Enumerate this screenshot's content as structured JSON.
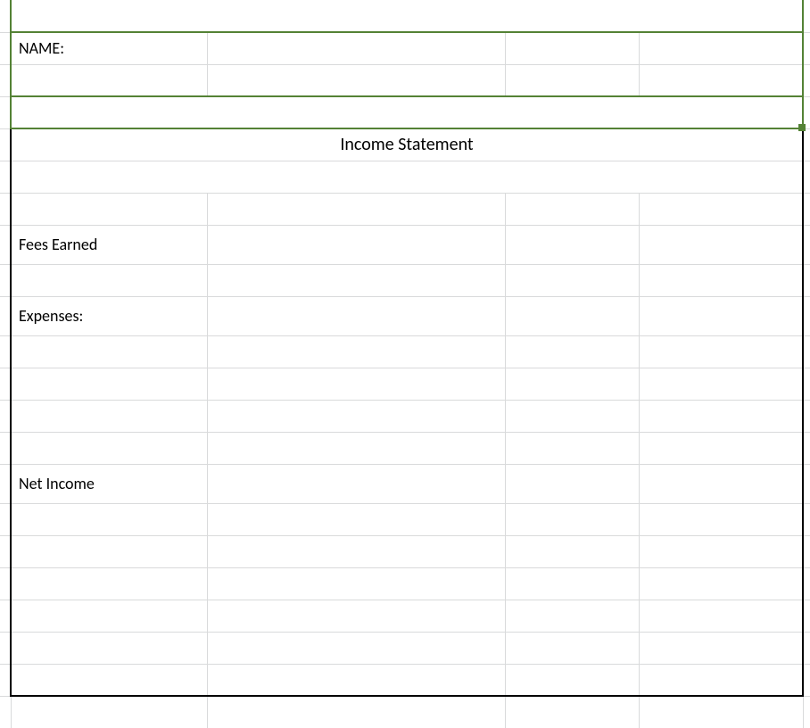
{
  "header": {
    "name_label": "NAME:"
  },
  "statement": {
    "title": "Income Statement",
    "rows": {
      "fees_earned": "Fees Earned",
      "expenses": "Expenses:",
      "net_income": "Net Income"
    }
  }
}
